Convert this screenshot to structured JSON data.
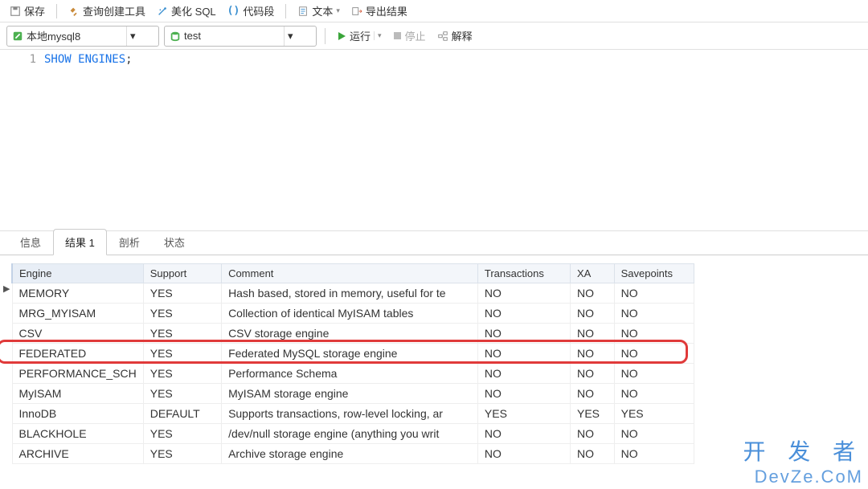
{
  "toolbar": {
    "save": "保存",
    "query_tool": "查询创建工具",
    "beautify": "美化 SQL",
    "snippet": "代码段",
    "text": "文本",
    "export": "导出结果"
  },
  "second_bar": {
    "connection": "本地mysql8",
    "database": "test",
    "run": "运行",
    "stop": "停止",
    "explain": "解释"
  },
  "editor": {
    "line_no": "1",
    "kw": "SHOW",
    "kw2": "ENGINES",
    "semi": ";"
  },
  "tabs": {
    "info": "信息",
    "result": "结果 1",
    "profile": "剖析",
    "status": "状态"
  },
  "table": {
    "headers": [
      "Engine",
      "Support",
      "Comment",
      "Transactions",
      "XA",
      "Savepoints"
    ],
    "rows": [
      {
        "engine": "MEMORY",
        "support": "YES",
        "comment": "Hash based, stored in memory, useful for te",
        "trans": "NO",
        "xa": "NO",
        "save": "NO"
      },
      {
        "engine": "MRG_MYISAM",
        "support": "YES",
        "comment": "Collection of identical MyISAM tables",
        "trans": "NO",
        "xa": "NO",
        "save": "NO"
      },
      {
        "engine": "CSV",
        "support": "YES",
        "comment": "CSV storage engine",
        "trans": "NO",
        "xa": "NO",
        "save": "NO"
      },
      {
        "engine": "FEDERATED",
        "support": "YES",
        "comment": "Federated MySQL storage engine",
        "trans": "NO",
        "xa": "NO",
        "save": "NO",
        "highlight": true
      },
      {
        "engine": "PERFORMANCE_SCH",
        "support": "YES",
        "comment": "Performance Schema",
        "trans": "NO",
        "xa": "NO",
        "save": "NO"
      },
      {
        "engine": "MyISAM",
        "support": "YES",
        "comment": "MyISAM storage engine",
        "trans": "NO",
        "xa": "NO",
        "save": "NO"
      },
      {
        "engine": "InnoDB",
        "support": "DEFAULT",
        "comment": "Supports transactions, row-level locking, ar",
        "trans": "YES",
        "xa": "YES",
        "save": "YES"
      },
      {
        "engine": "BLACKHOLE",
        "support": "YES",
        "comment": "/dev/null storage engine (anything you writ",
        "trans": "NO",
        "xa": "NO",
        "save": "NO"
      },
      {
        "engine": "ARCHIVE",
        "support": "YES",
        "comment": "Archive storage engine",
        "trans": "NO",
        "xa": "NO",
        "save": "NO"
      }
    ]
  },
  "watermark": {
    "top": "开 发 者",
    "bottom": "DevZe.CoM"
  }
}
